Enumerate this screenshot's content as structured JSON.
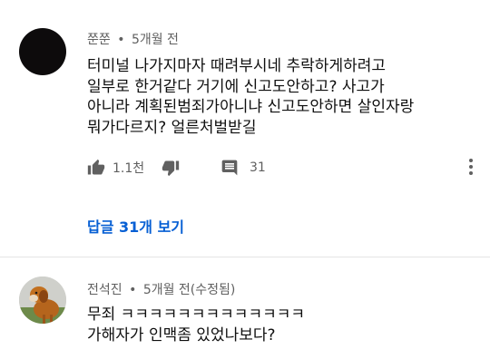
{
  "comments": [
    {
      "author": "쭌쭌",
      "time": "5개월 전",
      "lines": [
        "터미널 나가지마자 때려부시네 추락하게하려고",
        "일부로 한거같다 거기에 신고도안하고? 사고가",
        "아니라 계획된범죄가아니냐 신고도안하면 살인자랑",
        "뭐가다르지? 얼른처벌받길"
      ],
      "likes": "1.1천",
      "reply_count": "31",
      "replies_link": "답글 31개 보기"
    },
    {
      "author": "전석진",
      "time": "5개월 전(수정됨)",
      "lines": [
        "무죄 ㅋㅋㅋㅋㅋㅋㅋㅋㅋㅋㅋㅋㅋ",
        "가해자가 인맥좀 있었나보다?"
      ]
    }
  ],
  "meta_separator": "•",
  "icons": {
    "like": "thumbs-up-icon",
    "dislike": "thumbs-down-icon",
    "reply": "comment-icon",
    "more": "more-vertical-icon"
  },
  "colors": {
    "text": "#0f0f0f",
    "meta": "#606060",
    "link": "#065fd4",
    "icon": "#606060"
  }
}
